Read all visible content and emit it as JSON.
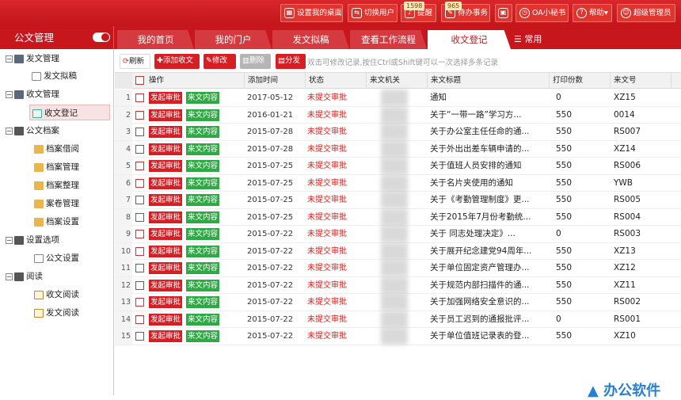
{
  "topbar": {
    "buttons": [
      {
        "label": "设置我的桌面",
        "icon": "desktop-grid-icon"
      },
      {
        "label": "切换用户",
        "icon": "user-switch-icon"
      },
      {
        "label": "提醒",
        "icon": "bell-icon",
        "badge": "1598"
      },
      {
        "label": "待办事务",
        "icon": "todo-icon",
        "badge": "965"
      },
      {
        "label": "",
        "icon": "lock-icon"
      },
      {
        "label": "OA小秘书",
        "icon": "clock-icon"
      },
      {
        "label": "帮助",
        "icon": "help-icon"
      },
      {
        "label": "超级管理员",
        "icon": "user-icon"
      }
    ]
  },
  "brand": "公文管理",
  "tabs": [
    "我的首页",
    "我的门户",
    "发文拟稿",
    "查看工作流程",
    "收文登记"
  ],
  "active_tab": "收文登记",
  "tab_common": "常用",
  "sidebar": [
    {
      "label": "发文管理",
      "level": 0
    },
    {
      "label": "发文拟稿",
      "level": 1
    },
    {
      "label": "收文管理",
      "level": 0
    },
    {
      "label": "收文登记",
      "level": 1,
      "selected": true
    },
    {
      "label": "公文档案",
      "level": 0
    },
    {
      "label": "档案借阅",
      "level": 1
    },
    {
      "label": "档案管理",
      "level": 1
    },
    {
      "label": "档案整理",
      "level": 1
    },
    {
      "label": "案卷管理",
      "level": 1
    },
    {
      "label": "档案设置",
      "level": 1
    },
    {
      "label": "设置选项",
      "level": 0
    },
    {
      "label": "公文设置",
      "level": 1
    },
    {
      "label": "阅读",
      "level": 0
    },
    {
      "label": "收文阅读",
      "level": 1
    },
    {
      "label": "发文阅读",
      "level": 1
    }
  ],
  "toolbar": {
    "refresh": "刷新",
    "add": "添加收文",
    "edit": "修改",
    "delete": "删除",
    "share": "分发",
    "hint": "双击可修改记录,按住Ctrl或Shift键可以一次选择多条记录"
  },
  "columns": [
    "操作",
    "添加时间",
    "状态",
    "来文机关",
    "来文标题",
    "打印份数",
    "来文号"
  ],
  "row_actions": {
    "approve": "发起审批",
    "content": "来文内容"
  },
  "rows": [
    {
      "n": "1",
      "date": "2017-05-12",
      "state": "未提交审批",
      "title": "通知",
      "print": "0",
      "no": "XZ15"
    },
    {
      "n": "2",
      "date": "2016-01-21",
      "state": "未提交审批",
      "title": "关于“一带一路”学习方...",
      "print": "550",
      "no": "0014"
    },
    {
      "n": "3",
      "date": "2015-07-28",
      "state": "未提交审批",
      "title": "关于办公室主任任命的通...",
      "print": "550",
      "no": "RS007"
    },
    {
      "n": "4",
      "date": "2015-07-28",
      "state": "未提交审批",
      "title": "关于外出出差车辆申请的...",
      "print": "550",
      "no": "XZ14"
    },
    {
      "n": "5",
      "date": "2015-07-25",
      "state": "未提交审批",
      "title": "关于值班人员安排的通知",
      "print": "550",
      "no": "RS006"
    },
    {
      "n": "6",
      "date": "2015-07-25",
      "state": "未提交审批",
      "title": "关于名片夹使用的通知",
      "print": "550",
      "no": "YWB"
    },
    {
      "n": "7",
      "date": "2015-07-25",
      "state": "未提交审批",
      "title": "关于《考勤管理制度》更...",
      "print": "550",
      "no": "RS005"
    },
    {
      "n": "8",
      "date": "2015-07-25",
      "state": "未提交审批",
      "title": "关于2015年7月份考勤统...",
      "print": "550",
      "no": "RS004"
    },
    {
      "n": "9",
      "date": "2015-07-22",
      "state": "未提交审批",
      "title": "关于       同志处理决定》...",
      "print": "0",
      "no": "RS003"
    },
    {
      "n": "10",
      "date": "2015-07-22",
      "state": "未提交审批",
      "title": "关于展开纪念建党94周年...",
      "print": "550",
      "no": "XZ13"
    },
    {
      "n": "11",
      "date": "2015-07-22",
      "state": "未提交审批",
      "title": "关于单位固定资产管理办...",
      "print": "550",
      "no": "XZ12"
    },
    {
      "n": "12",
      "date": "2015-07-22",
      "state": "未提交审批",
      "title": "关于规范内部扫描件的通...",
      "print": "550",
      "no": "XZ11"
    },
    {
      "n": "13",
      "date": "2015-07-22",
      "state": "未提交审批",
      "title": "关于加强网络安全意识的...",
      "print": "550",
      "no": "RS002"
    },
    {
      "n": "14",
      "date": "2015-07-22",
      "state": "未提交审批",
      "title": "关于员工迟到的通报批评...",
      "print": "0",
      "no": "RS001"
    },
    {
      "n": "15",
      "date": "2015-07-22",
      "state": "未提交审批",
      "title": "关于单位值班记录表的登...",
      "print": "550",
      "no": "XZ10"
    }
  ],
  "watermark": "办公软件"
}
